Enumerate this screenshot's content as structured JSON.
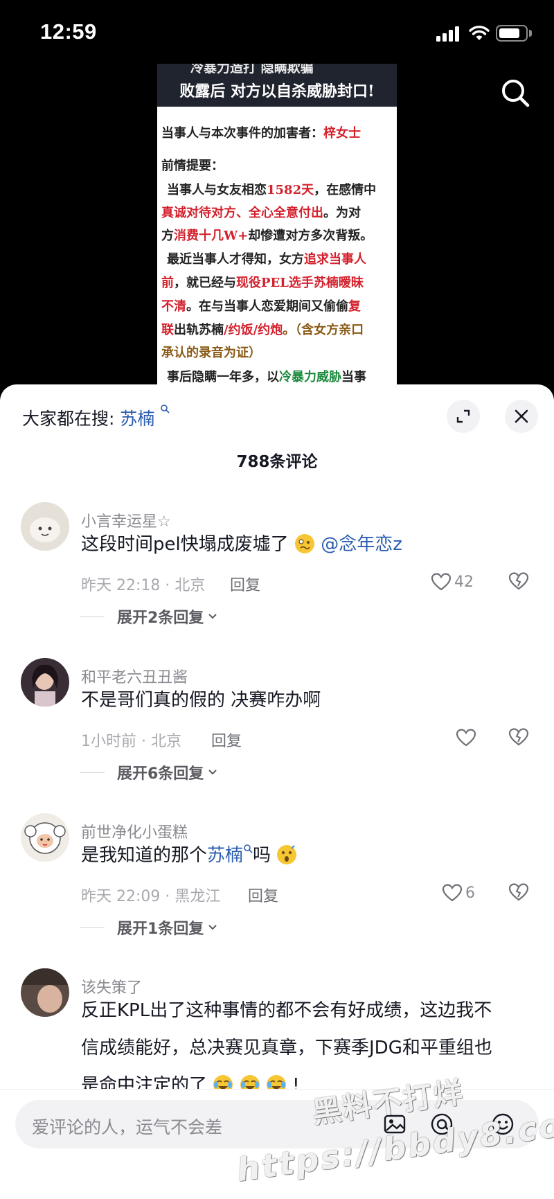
{
  "status_bar": {
    "time": "12:59",
    "battery_level": 0.8
  },
  "video": {
    "top_cut_text": "冷暴力造打 隐瞒欺骗",
    "headline": "败露后 对方以自杀威胁封口!",
    "line1_black": "当事人与本次事件的加害者：",
    "line1_red": "梓女士",
    "line2": "前情提要：",
    "line3_a": "当事人与女友相恋",
    "line3_red": "1582天",
    "line3_b": "，在感情中",
    "line4_red": "真诚对待对方、全心全意付出",
    "line4_b": "。为对",
    "line5_a": "方",
    "line5_red": "消费十几W+",
    "line5_b": "却惨遭对方多次背叛。",
    "line6_a": "最近当事人才得知，女方",
    "line6_red": "追求当事人",
    "line7_red1": "前",
    "line7_b": "，就已经与",
    "line7_red2": "现役PEL选手苏楠暧昧",
    "line8_red": "不清",
    "line8_b": "。在与当事人恋爱期间又偷偷",
    "line8_red2": "复",
    "line9_red": "联",
    "line9_b": "出轨苏楠",
    "line9_red2": "/约饭/约炮",
    "line9_brown": "。（含女方亲口",
    "line10_brown": "承认的录音为证）",
    "line11_a": "事后隐瞒一年多，以",
    "line11_green": "冷暴力威胁",
    "line11_b": "当事"
  },
  "sheet": {
    "search_hint_label": "大家都在搜:",
    "search_hint_keyword": "苏楠",
    "comment_count": "788条评论"
  },
  "comments": [
    {
      "username": "小言幸运星☆",
      "text": "这段时间pel快塌成废墟了",
      "mention": "@念年恋z",
      "meta": "昨天 22:18 · 北京",
      "reply": "回复",
      "likes": "42",
      "expand": "展开2条回复"
    },
    {
      "username": "和平老六丑丑酱",
      "text": "不是哥们真的假的 决赛咋办啊",
      "meta": "1小时前 · 北京",
      "reply": "回复",
      "likes": "",
      "expand": "展开6条回复"
    },
    {
      "username": "前世净化小蛋糕",
      "text_a": "是我知道的那个",
      "keyword": "苏楠",
      "text_b": "吗",
      "meta": "昨天 22:09 · 黑龙江",
      "reply": "回复",
      "likes": "6",
      "expand": "展开1条回复"
    },
    {
      "username": "该失策了",
      "lines": [
        "反正KPL出了这种事情的都不会有好成绩，这边我不",
        "信成绩能好，总决赛见真章，下赛季JDG和平重组也",
        "是命中注定的了"
      ],
      "tail": "!"
    }
  ],
  "input": {
    "placeholder": "爱评论的人，运气不会差"
  },
  "watermark": {
    "line1": "黑料不打烊",
    "line2": "https://bbdy8.com"
  },
  "colors": {
    "link": "#2a5db0",
    "accent_red": "#d3212c",
    "text": "#161823",
    "muted": "#8a8b91"
  }
}
